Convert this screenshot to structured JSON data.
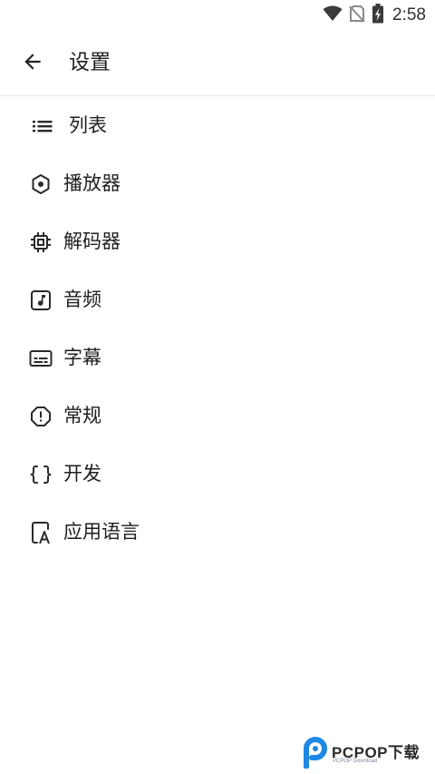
{
  "status_bar": {
    "time": "2:58",
    "icons": [
      "wifi-icon",
      "no-sim-icon",
      "battery-charging-icon"
    ]
  },
  "app_bar": {
    "back_icon": "arrow-left-icon",
    "title": "设置"
  },
  "menu": {
    "items": [
      {
        "label": "列表",
        "icon": "list-icon"
      },
      {
        "label": "播放器",
        "icon": "hexagon-dot-icon"
      },
      {
        "label": "解码器",
        "icon": "chip-icon"
      },
      {
        "label": "音频",
        "icon": "music-note-icon"
      },
      {
        "label": "字幕",
        "icon": "subtitles-icon"
      },
      {
        "label": "常规",
        "icon": "alert-octagon-icon"
      },
      {
        "label": "开发",
        "icon": "code-braces-icon"
      },
      {
        "label": "应用语言",
        "icon": "language-icon"
      }
    ]
  },
  "watermark": {
    "brand": "PCPOP下载",
    "sub": "PCPOP Download",
    "colors": {
      "logo": "#1e88e5",
      "text": "#2b2b2b"
    }
  },
  "colors": {
    "background": "#ffffff",
    "text": "#1e1e1e",
    "icon": "#2a2a2a",
    "divider": "#e6e6e6"
  }
}
